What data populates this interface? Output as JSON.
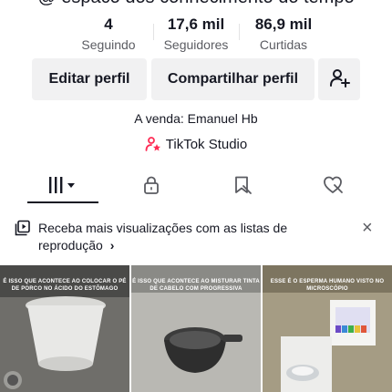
{
  "header": {
    "handle_partial": "@ espaco dos conhecimento do tempo"
  },
  "stats": [
    {
      "value": "4",
      "label": "Seguindo"
    },
    {
      "value": "17,6 mil",
      "label": "Seguidores"
    },
    {
      "value": "86,9 mil",
      "label": "Curtidas"
    }
  ],
  "actions": {
    "edit_label": "Editar perfil",
    "share_label": "Compartilhar perfil",
    "add_friend_icon": "add-person-icon"
  },
  "profile": {
    "seller_text": "A venda: Emanuel Hb",
    "studio_label": "TikTok Studio",
    "studio_icon": "studio-person-star-icon"
  },
  "tabs": [
    {
      "icon": "grid-icon",
      "selected": true
    },
    {
      "icon": "lock-icon",
      "selected": false
    },
    {
      "icon": "bookmark-icon",
      "selected": false
    },
    {
      "icon": "heart-icon",
      "selected": false
    }
  ],
  "promo": {
    "text": "Receba mais visualizações com as listas de reprodução",
    "chevron": "›",
    "close": "×"
  },
  "videos": [
    {
      "caption": "É ISSO QUE ACONTECE AO COLOCAR O PÉ DE PORCO NO ÁCIDO DO ESTÔMAGO"
    },
    {
      "caption": "É ISSO QUE ACONTECE AO MISTURAR TINTA DE CABELO COM PROGRESSIVA"
    },
    {
      "caption": "ESSE É O ESPERMA HUMANO VISTO NO MICROSCÓPIO"
    }
  ],
  "colors": {
    "accent": "#fe2c55",
    "text": "#161823",
    "muted": "#5b5c62",
    "button_bg": "#f1f1f2"
  }
}
